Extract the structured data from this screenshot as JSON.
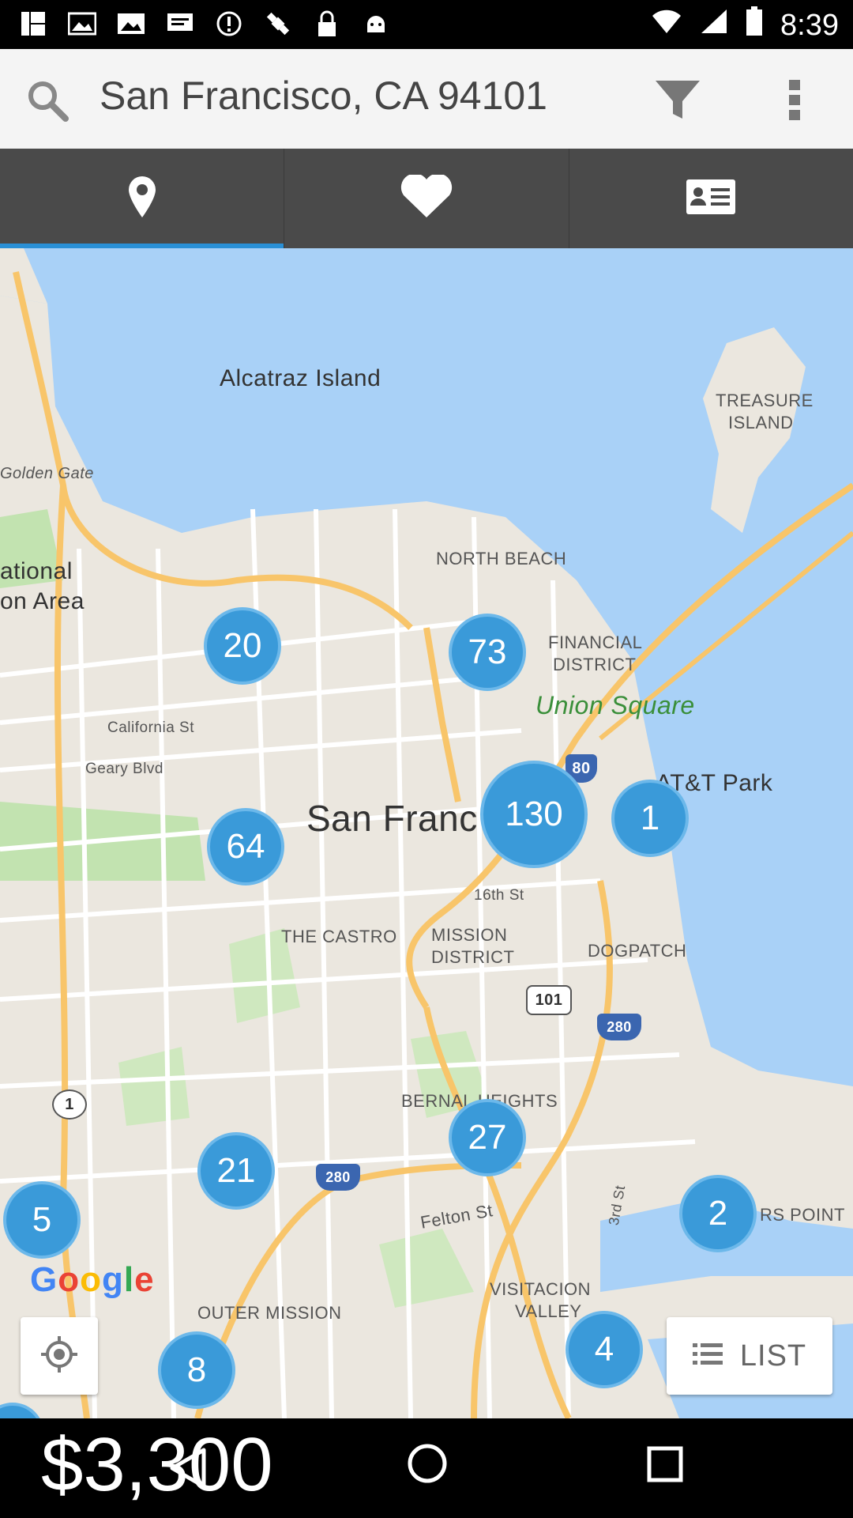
{
  "status_bar": {
    "time": "8:39",
    "icons": [
      "notification-icon",
      "photo-icon",
      "image-icon",
      "message-icon",
      "alert-icon",
      "satellite-icon",
      "lock-icon",
      "android-icon",
      "wifi-icon",
      "signal-icon",
      "battery-icon"
    ]
  },
  "header": {
    "location": "San Francisco, CA 94101"
  },
  "tabs": [
    {
      "name": "map-tab",
      "icon": "map-pin-icon",
      "active": true
    },
    {
      "name": "favorites-tab",
      "icon": "heart-icon",
      "active": false
    },
    {
      "name": "contact-tab",
      "icon": "contact-card-icon",
      "active": false
    }
  ],
  "map": {
    "labels": {
      "alcatraz": "Alcatraz Island",
      "treasure1": "TREASURE",
      "treasure2": "ISLAND",
      "golden_gate": "Golden Gate",
      "national1": "ational",
      "national2": "on Area",
      "north_beach": "NORTH BEACH",
      "financial1": "FINANCIAL",
      "financial2": "DISTRICT",
      "union_square": "Union Square",
      "california": "California St",
      "geary": "Geary Blvd",
      "att_park": "AT&T Park",
      "san_francisco": "San Franc",
      "sixteenth": "16th St",
      "castro": "THE CASTRO",
      "mission1": "MISSION",
      "mission2": "DISTRICT",
      "dogpatch": "DOGPATCH",
      "bernal": "BERNAL HEIGHTS",
      "felton": "Felton St",
      "hunters": "RS POINT",
      "third": "3rd St",
      "visitacion1": "VISITACION",
      "visitacion2": "VALLEY",
      "outer_mission": "OUTER MISSION",
      "hwy80": "80",
      "hwy101": "101",
      "hwy280a": "280",
      "hwy280b": "280",
      "hwy1": "1"
    },
    "clusters": [
      {
        "count": "20"
      },
      {
        "count": "73"
      },
      {
        "count": "130"
      },
      {
        "count": "1"
      },
      {
        "count": "64"
      },
      {
        "count": "27"
      },
      {
        "count": "21"
      },
      {
        "count": "5"
      },
      {
        "count": "2"
      },
      {
        "count": "4"
      },
      {
        "count": "8"
      }
    ],
    "google": [
      "G",
      "o",
      "o",
      "g",
      "l",
      "e"
    ],
    "list_button": "LIST"
  },
  "bottom": {
    "price": "$3,300"
  }
}
